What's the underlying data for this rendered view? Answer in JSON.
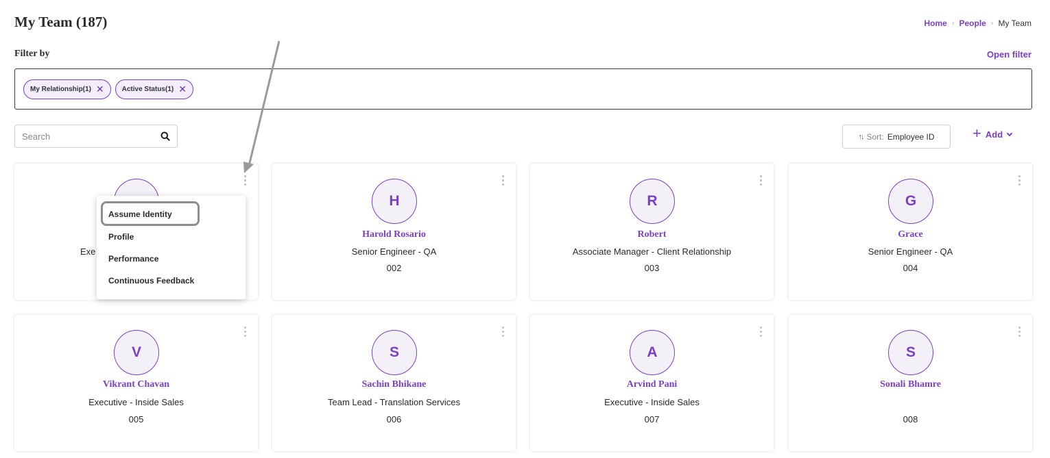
{
  "header": {
    "title": "My Team (187)",
    "breadcrumb": [
      {
        "label": "Home"
      },
      {
        "label": "People"
      },
      {
        "label": "My Team"
      }
    ]
  },
  "filter": {
    "label": "Filter by",
    "open_label": "Open filter",
    "chips": [
      {
        "label": "My Relationship(1)"
      },
      {
        "label": "Active Status(1)"
      }
    ]
  },
  "search": {
    "placeholder": "Search"
  },
  "sort": {
    "prefix": "Sort:",
    "value": "Employee ID"
  },
  "add": {
    "label": "Add"
  },
  "employees": [
    {
      "initial": "",
      "name": "",
      "role": "Exe",
      "id": ""
    },
    {
      "initial": "H",
      "name": "Harold Rosario",
      "role": "Senior Engineer - QA",
      "id": "002"
    },
    {
      "initial": "R",
      "name": "Robert",
      "role": "Associate Manager - Client Relationship",
      "id": "003"
    },
    {
      "initial": "G",
      "name": "Grace",
      "role": "Senior Engineer - QA",
      "id": "004"
    },
    {
      "initial": "V",
      "name": "Vikrant Chavan",
      "role": "Executive - Inside Sales",
      "id": "005"
    },
    {
      "initial": "S",
      "name": "Sachin Bhikane",
      "role": "Team Lead - Translation Services",
      "id": "006"
    },
    {
      "initial": "A",
      "name": "Arvind Pani",
      "role": "Executive - Inside Sales",
      "id": "007"
    },
    {
      "initial": "S",
      "name": "Sonali Bhamre",
      "role": "",
      "id": "008"
    }
  ],
  "context_menu": {
    "items": [
      {
        "label": "Assume Identity"
      },
      {
        "label": "Profile"
      },
      {
        "label": "Performance"
      },
      {
        "label": "Continuous Feedback"
      }
    ]
  },
  "colors": {
    "accent": "#7b3fc4",
    "chip_bg": "#f4eefc"
  }
}
